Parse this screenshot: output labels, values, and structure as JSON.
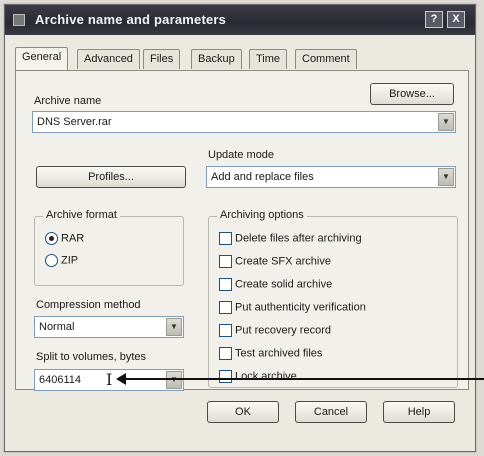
{
  "window": {
    "title": "Archive name and parameters",
    "help_btn": "?",
    "close_btn": "X"
  },
  "tabs": [
    {
      "label": "General",
      "active": true
    },
    {
      "label": "Advanced"
    },
    {
      "label": "Files"
    },
    {
      "label": "Backup"
    },
    {
      "label": "Time"
    },
    {
      "label": "Comment"
    }
  ],
  "archive_name": {
    "label": "Archive name",
    "value": "DNS Server.rar",
    "browse_label": "Browse..."
  },
  "update_mode": {
    "label": "Update mode",
    "value": "Add and replace files"
  },
  "profiles_label": "Profiles...",
  "archive_format": {
    "title": "Archive format",
    "options": [
      {
        "label": "RAR",
        "checked": true
      },
      {
        "label": "ZIP",
        "checked": false
      }
    ]
  },
  "compression": {
    "label": "Compression method",
    "value": "Normal"
  },
  "split": {
    "label": "Split to volumes, bytes",
    "value": "6406114"
  },
  "archiving_options": {
    "title": "Archiving options",
    "items": [
      "Delete files after archiving",
      "Create SFX archive",
      "Create solid archive",
      "Put authenticity verification",
      "Put recovery record",
      "Test archived files",
      "Lock archive"
    ]
  },
  "buttons": {
    "ok": "OK",
    "cancel": "Cancel",
    "help": "Help"
  }
}
